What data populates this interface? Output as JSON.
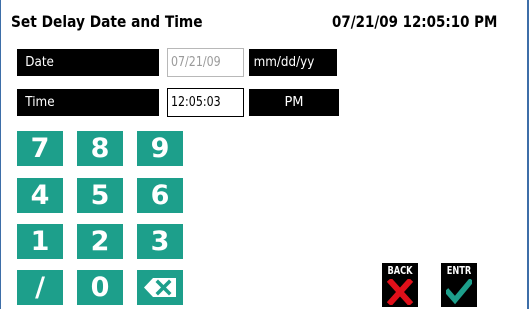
{
  "header": {
    "title": "Set Delay Date and Time",
    "clock": "07/21/09 12:05:10 PM"
  },
  "date_row": {
    "label": "Date",
    "value": "07/21/09",
    "format": "mm/dd/yy"
  },
  "time_row": {
    "label": "Time",
    "value": "12:05:03",
    "meridiem": "PM"
  },
  "keypad": {
    "keys": [
      "7",
      "8",
      "9",
      "4",
      "5",
      "6",
      "1",
      "2",
      "3",
      "/",
      "0"
    ],
    "backspace_icon": "backspace-icon",
    "color": "#1d9f8b"
  },
  "actions": {
    "back_label": "BACK",
    "back_icon": "x-mark-icon",
    "back_icon_color": "#e0101a",
    "enter_label": "ENTR",
    "enter_icon": "checkmark-icon",
    "enter_icon_color": "#1d9f8b"
  }
}
